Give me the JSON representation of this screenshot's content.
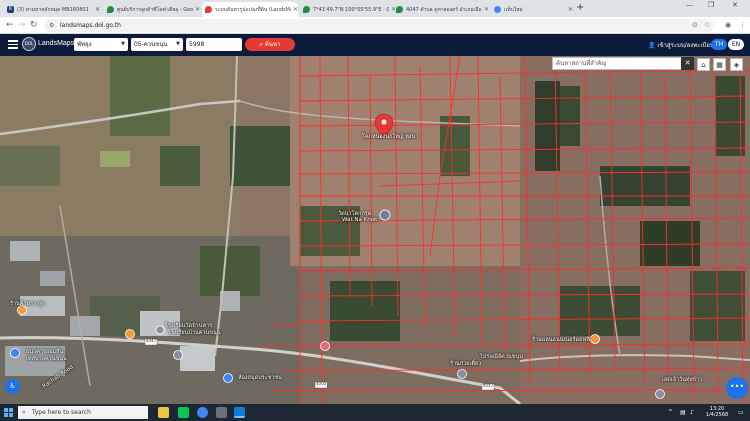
{
  "browser": {
    "tabs": [
      {
        "title": "(3) ตามหาหลักหมุด MB160801",
        "favicon_color": "#1f3f74",
        "favicon_label": "K"
      },
      {
        "title": "ศูนย์บริการลูกค้าซีโอฟ เดียอุ - Goo",
        "favicon_color": "#1e8e3e",
        "favicon_label": ""
      },
      {
        "title": "ระบบค้นหารูปแปลงที่ดิน (LandsMa",
        "favicon_color": "#e53935",
        "favicon_label": ""
      },
      {
        "title": "7°41'49.7\"N 100°05'55.9\"E - Go",
        "favicon_color": "#1e8e3e",
        "favicon_label": ""
      },
      {
        "title": "4047 ตำบล ดูหาสองดร์ อำเภอเมือง",
        "favicon_color": "#1e8e3e",
        "favicon_label": ""
      },
      {
        "title": "แท็บใหม่",
        "favicon_color": "#4285f4",
        "favicon_label": ""
      }
    ],
    "new_tab_symbol": "+",
    "url": "landsmaps.dol.go.th"
  },
  "header": {
    "brand": "LandsMaps",
    "logo_text": "DOL",
    "province": "พัทลุง",
    "district": "05-ควนขนุน",
    "parcel_number": "5998",
    "search_label": "ค้นหา",
    "login_label": "เข้าสู่ระบบ/ลงทะเบียน",
    "lang_th": "TH",
    "lang_en": "EN"
  },
  "map": {
    "search_placeholder": "ค้นหาสถานที่สำคัญ",
    "clear_symbol": "✕",
    "labels": {
      "pin_label": "โคกหนองนกใหญ่ ทุ่งนา",
      "temple": "วัดนาโคกกรูด",
      "temple_sub": "Wat Na Khok",
      "shop1": "ร้านค้าเพชรอาหาร",
      "store": "ร้านค้ายาว ลูก",
      "school1": "โรงเรียนวัดบ้านหาร",
      "school2": "ห้องสมุดประชาชน",
      "school3": "โรงเรียนบ้านควนขนุน",
      "cafe": "ร้านแสดงกเอริช",
      "left1": "วัดหมู่บ้านควนขนุน",
      "left2": "ธนาคารออมสิน",
      "left3": "เทศบาลควนขนุน",
      "bottom1": "ร้านก๋วยเตี๋ยว",
      "bottom2": "ไปรษณีย์ควนขนุน",
      "bottom3": "สถานีตำรวจภูธร",
      "market": "ร้านแลนแนนเนอร์ดอฟฟี่",
      "right_bottom": "เสดเจ้าวันทุ่งข้าว",
      "road1": "4047",
      "road2": "4005",
      "road3": "4047",
      "left_road": "Rachab Road"
    }
  },
  "taskbar": {
    "search_placeholder": "Type here to search",
    "time": "13:20",
    "date": "1/4/2568"
  }
}
